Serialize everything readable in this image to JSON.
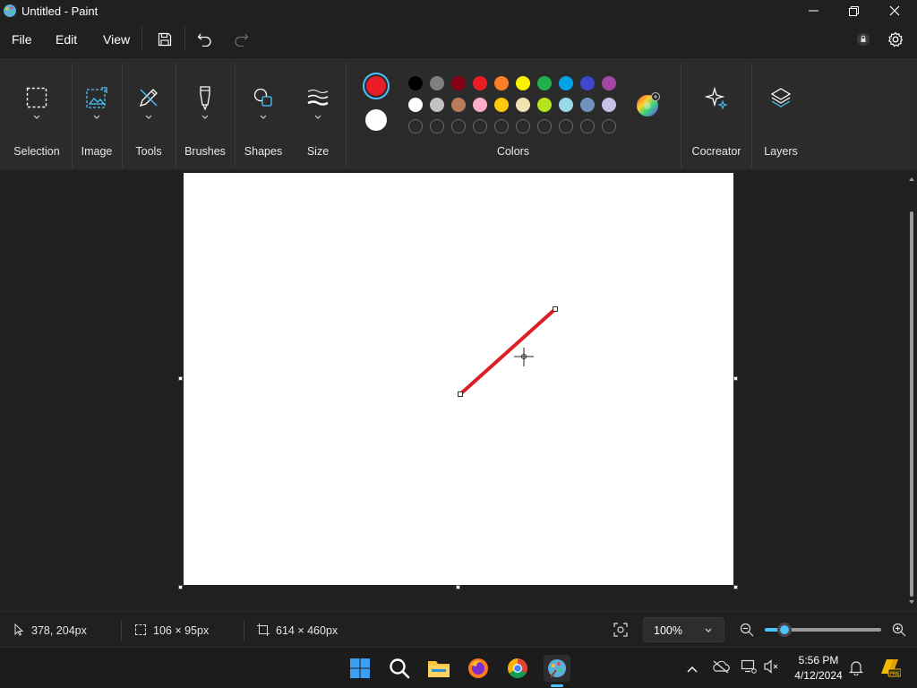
{
  "window": {
    "title": "Untitled - Paint"
  },
  "menu": {
    "file": "File",
    "edit": "Edit",
    "view": "View"
  },
  "ribbon": {
    "groups": {
      "selection": "Selection",
      "image": "Image",
      "tools": "Tools",
      "brushes": "Brushes",
      "shapes": "Shapes",
      "size": "Size",
      "colors": "Colors",
      "cocreator": "Cocreator",
      "layers": "Layers"
    },
    "primary_color": "#e81c24",
    "secondary_color": "#ffffff",
    "palette_row1": [
      "#000000",
      "#7f7f7f",
      "#880015",
      "#ed1c24",
      "#ff7f27",
      "#fff200",
      "#22b14c",
      "#00a2e8",
      "#3f48cc",
      "#a349a4"
    ],
    "palette_row2": [
      "#ffffff",
      "#c3c3c3",
      "#b97a57",
      "#ffaec9",
      "#ffc90e",
      "#efe4b0",
      "#b5e61d",
      "#99d9ea",
      "#7092be",
      "#c8bfe7"
    ],
    "palette_row3_empty_slots": 10
  },
  "status": {
    "cursor_position": "378, 204px",
    "selection_size": "106 × 95px",
    "canvas_size": "614 × 460px",
    "zoom": "100%"
  },
  "taskbar": {
    "time": "5:56 PM",
    "date": "4/12/2024",
    "apps": [
      "start-icon",
      "search-icon",
      "file-explorer-icon",
      "firefox-icon",
      "chrome-icon",
      "paint-icon"
    ]
  },
  "colors": {
    "accent": "#4cc2ff",
    "line": "#dc1f26"
  }
}
